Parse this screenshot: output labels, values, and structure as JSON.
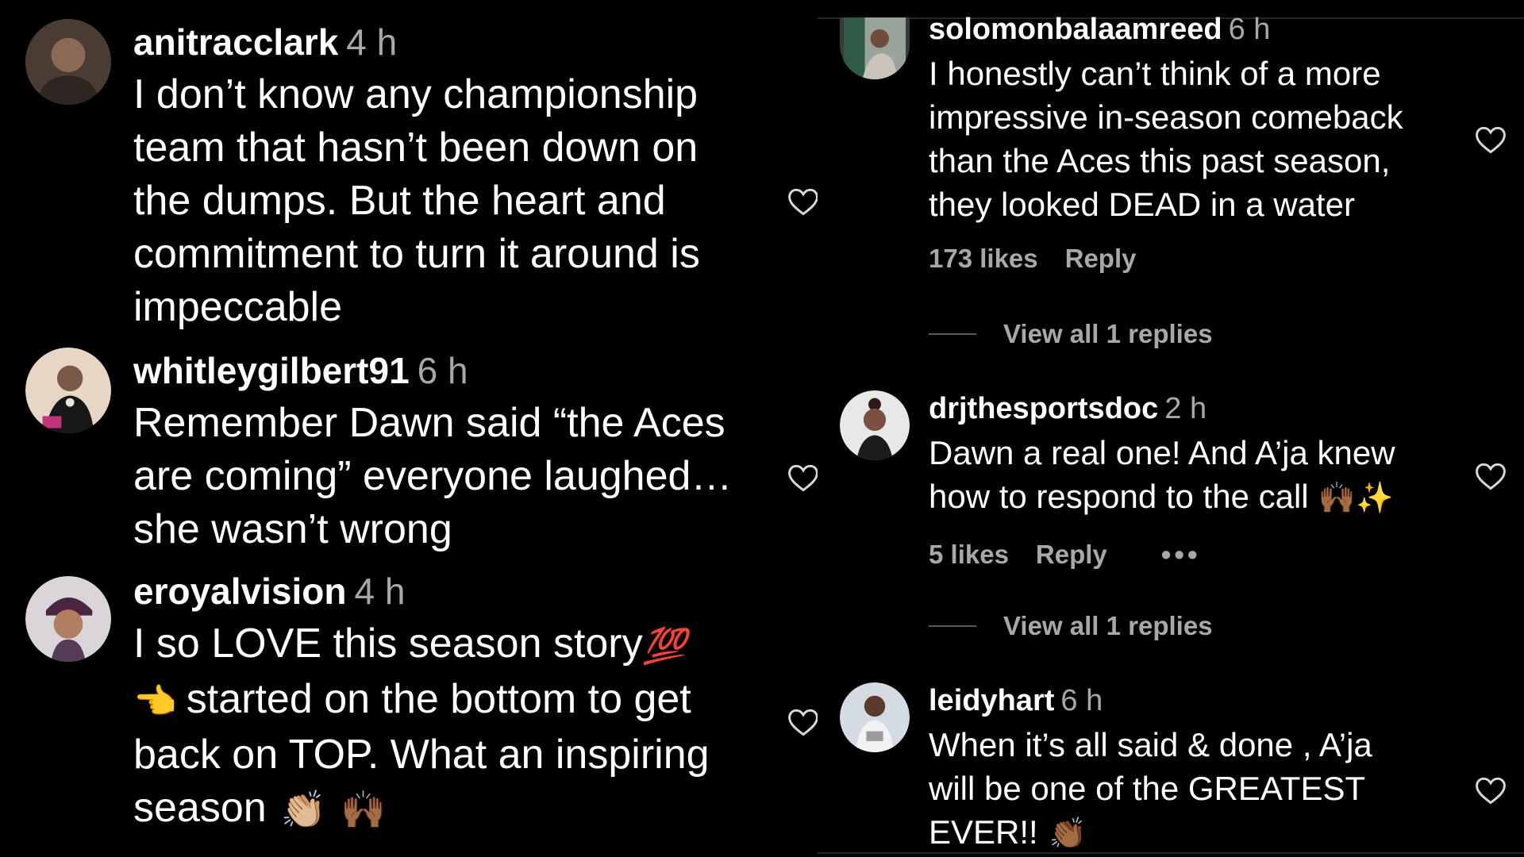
{
  "left": {
    "comments": [
      {
        "username": "anitracclark",
        "time": "4 h",
        "lines": [
          "I don’t know any championship",
          "team that hasn’t been down on",
          "the dumps. But the heart and",
          "commitment to turn it around is",
          "impeccable"
        ]
      },
      {
        "username": "whitleygilbert91",
        "time": "6 h",
        "lines": [
          "Remember Dawn said “the Aces",
          "are coming” everyone laughed…",
          "she wasn’t wrong"
        ]
      },
      {
        "username": "eroyalvision",
        "time": "4 h",
        "lines": [
          "I so LOVE this season story",
          "started on the bottom to get",
          "back on TOP. What an inspiring",
          "season"
        ],
        "emoji": {
          "hundred": "💯",
          "pointing": "👈",
          "clap": "👏🏼",
          "raised_hands": "🙌🏾"
        }
      }
    ]
  },
  "right": {
    "comments": [
      {
        "username": "solomonbalaamreed",
        "time": "6 h",
        "lines": [
          "I honestly can’t think of a more",
          "impressive in-season comeback",
          "than the Aces this past season,",
          "they looked DEAD in a water"
        ],
        "likes": "173 likes",
        "reply": "Reply",
        "view_replies": "View all 1 replies"
      },
      {
        "username": "drjthesportsdoc",
        "time": "2 h",
        "lines": [
          "Dawn a real one! And A’ja knew",
          "how to respond to the call"
        ],
        "emoji": "🙌🏾✨",
        "likes": "5 likes",
        "reply": "Reply",
        "more": "•••",
        "view_replies": "View all 1 replies"
      },
      {
        "username": "leidyhart",
        "time": "6 h",
        "lines": [
          "When it’s all said & done , A’ja",
          "will be one of the GREATEST",
          "EVER!!"
        ],
        "emoji": "👏🏾"
      }
    ]
  },
  "icons": {
    "heart": "heart-outline-icon",
    "avatar": "avatar"
  },
  "colors": {
    "background": "#000000",
    "text": "#ffffff",
    "secondary": "#a8a8a8"
  }
}
